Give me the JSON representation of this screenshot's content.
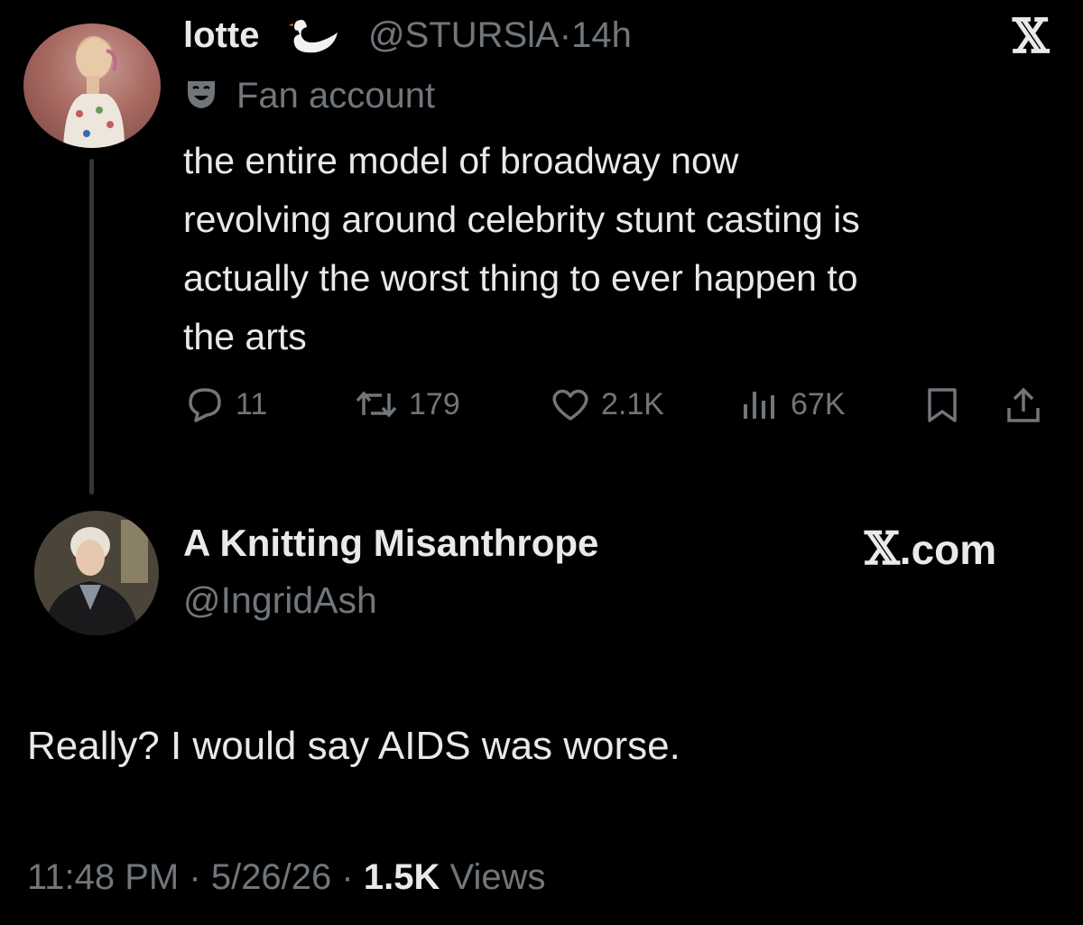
{
  "tweet1": {
    "author_name": "lotte",
    "name_emoji": "swan-emoji",
    "handle": "@STURSlA",
    "separator": "·",
    "time": "14h",
    "x_logo": "𝕏",
    "label_icon": "theater-mask-icon",
    "label": "Fan account",
    "text_lines": [
      "the entire model of broadway now",
      "revolving around celebrity stunt casting is",
      "actually the worst thing to ever happen to",
      "the arts"
    ],
    "actions": {
      "replies": "11",
      "reposts": "179",
      "likes": "2.1K",
      "views": "67K"
    }
  },
  "tweet2": {
    "author_name": "A Knitting Misanthrope",
    "handle": "@IngridAsh",
    "brand_x": "𝕏",
    "brand_suffix": ".com",
    "text": "Really? I would say AIDS was worse.",
    "footer": {
      "time": "11:48 PM",
      "sep1": "·",
      "date": "5/26/26",
      "sep2": "·",
      "views_count": "1.5K",
      "views_label": "Views"
    }
  },
  "colors": {
    "background": "#000000",
    "text": "#e7e9ea",
    "muted": "#71767b",
    "thread_line": "#333639"
  }
}
